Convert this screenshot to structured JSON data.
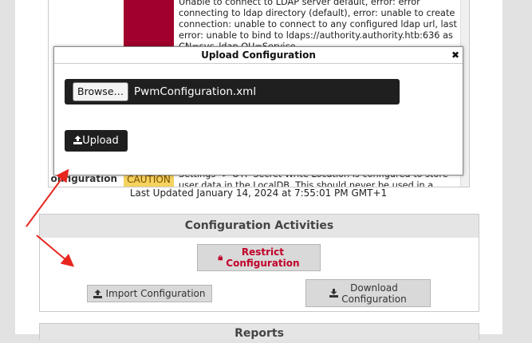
{
  "health": {
    "error_message": "Unable to connect to LDAP server default, error: error connecting to ldap directory (default), error: unable to create connection: unable to connect to any configured ldap url, last error: unable to bind to ldaps://authority.authority.htb:636 as CN=svc_ldap,OU=Service",
    "row2_label": "onfiguration",
    "row2_badge": "CAUTION",
    "row2_message": "Settings -> OTP Secret Write Location is configured to store user data in the LocalDB. This should never be used in a production"
  },
  "last_updated": "Last Updated January 14, 2024 at 7:55:01 PM GMT+1",
  "activities": {
    "title": "Configuration Activities",
    "restrict_label_1": "Restrict",
    "restrict_label_2": "Configuration",
    "import_label": "Import Configuration",
    "download_label_1": "Download",
    "download_label_2": "Configuration"
  },
  "reports": {
    "title": "Reports"
  },
  "modal": {
    "title": "Upload Configuration",
    "close_glyph": "✖",
    "browse_label": "Browse…",
    "file_name": "PwmConfiguration.xml",
    "upload_label": "Upload"
  },
  "colors": {
    "error_red": "#a0002b",
    "caution_yellow": "#f4d35e",
    "arrow_red": "#e8261f"
  }
}
